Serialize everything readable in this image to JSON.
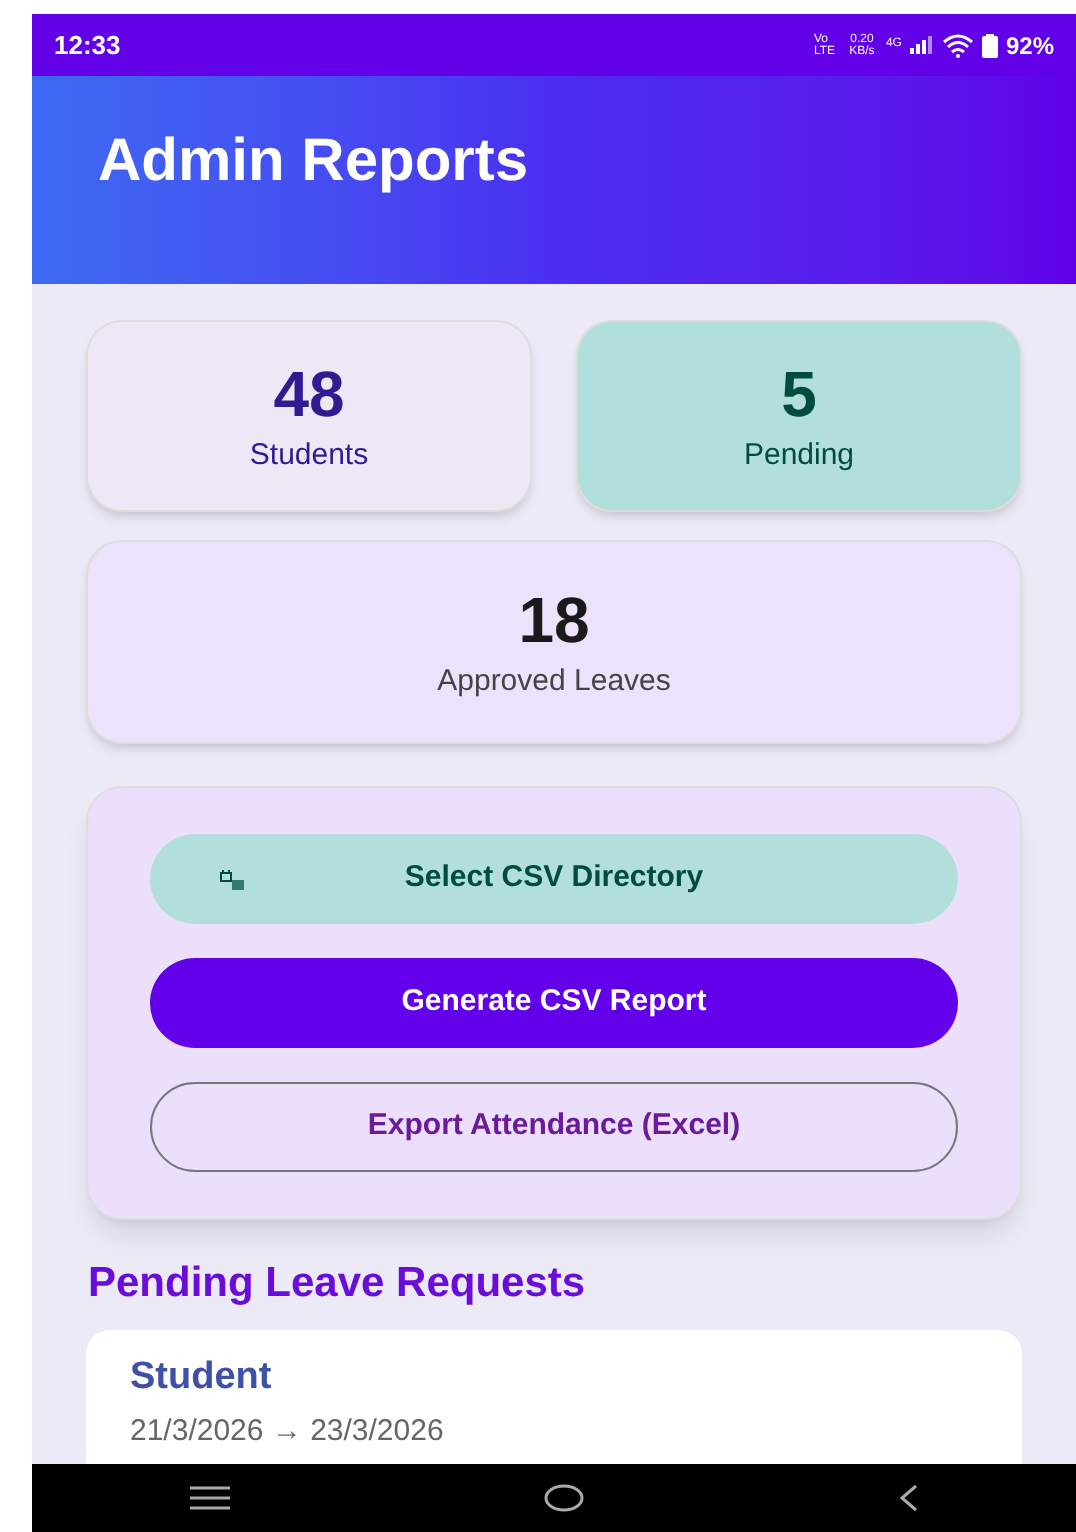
{
  "status_bar": {
    "time": "12:33",
    "volte": "Vo LTE",
    "speed": "0.20 KB/s",
    "network": "4G",
    "battery": "92%"
  },
  "header": {
    "title": "Admin Reports"
  },
  "stats": [
    {
      "value": "48",
      "label": "Students",
      "kind": "violet"
    },
    {
      "value": "5",
      "label": "Pending",
      "kind": "teal"
    },
    {
      "value": "18",
      "label": "Approved Leaves",
      "kind": "wide"
    }
  ],
  "actions": [
    {
      "label": "Select CSV Directory",
      "kind": "tonal"
    },
    {
      "label": "Generate CSV Report",
      "kind": "filled"
    },
    {
      "label": "Export Attendance (Excel)",
      "kind": "outlined"
    }
  ],
  "section_title": "Pending Leave Requests",
  "requests": [
    {
      "name": "Student",
      "dates": "21/3/2026 → 23/3/2026"
    }
  ]
}
